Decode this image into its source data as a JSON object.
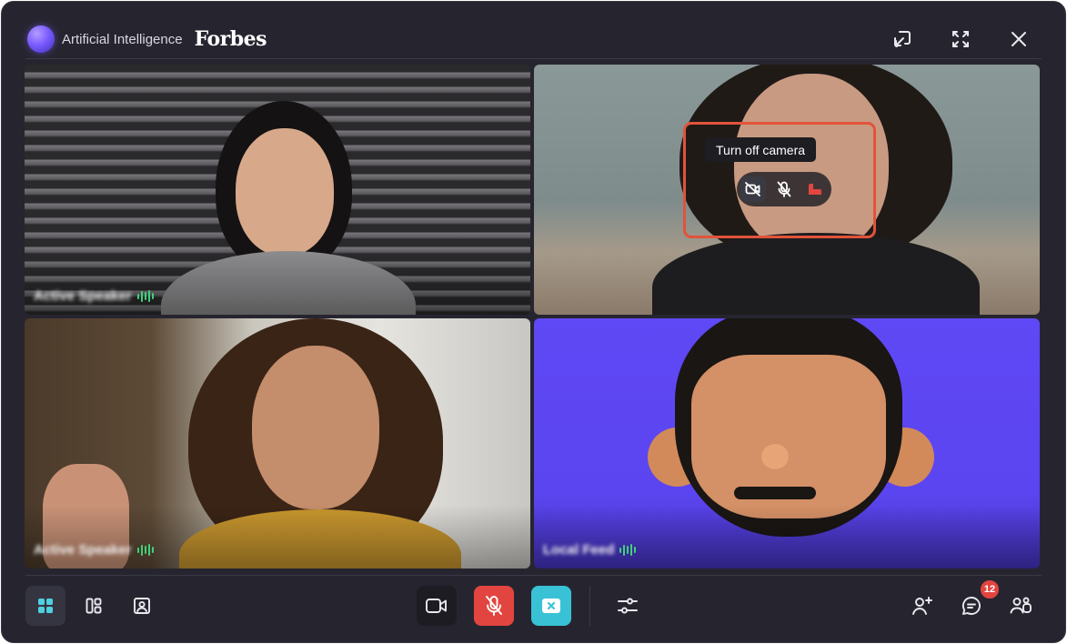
{
  "header": {
    "app_title": "Artificial Intelligence",
    "brand": "Forbes"
  },
  "tiles": [
    {
      "label": "Active Speaker",
      "speaking": true
    },
    {
      "label": "",
      "speaking": false
    },
    {
      "label": "Active Speaker",
      "speaking": true
    },
    {
      "label": "Local Feed",
      "speaking": true
    }
  ],
  "overlay": {
    "tooltip": "Turn off camera"
  },
  "toolbar": {
    "chat_unread": "12"
  },
  "colors": {
    "window_bg": "#26252f",
    "accent_red": "#e2453f",
    "accent_cyan": "#39c2d6",
    "speaking_green": "#3fd07a",
    "focus_ring": "#e1533a"
  }
}
